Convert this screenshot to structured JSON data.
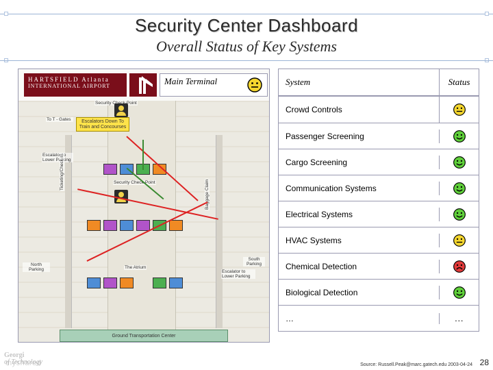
{
  "title": "Security Center Dashboard",
  "subtitle": "Overall Status of Key Systems",
  "map": {
    "brand_line1": "HARTSFIELD Atlanta",
    "brand_line2": "INTERNATIONAL AIRPORT",
    "header_label": "Main Terminal",
    "header_status": "neutral",
    "notice_text": "Escalators Down To Train and Concourses",
    "labels": {
      "security_checkpoint": "Security Check-Point",
      "checkpoint_top": "Security Check-Point",
      "gates": "To T - Gates",
      "escalator_left": "Escalator to Lower Parking",
      "escalator_right": "Escalator to Lower Parking",
      "north_parking": "North Parking",
      "south_parking": "South Parking",
      "ticketing": "Ticketing/Check-In",
      "baggage": "Baggage Claim",
      "atrium": "The Atrium",
      "ground_transport": "Ground Transportation Center"
    }
  },
  "status_table": {
    "header_system": "System",
    "header_status": "Status",
    "rows": [
      {
        "name": "Crowd Controls",
        "status": "neutral"
      },
      {
        "name": "Passenger Screening",
        "status": "ok"
      },
      {
        "name": "Cargo Screening",
        "status": "ok"
      },
      {
        "name": "Communication Systems",
        "status": "ok"
      },
      {
        "name": "Electrical Systems",
        "status": "ok"
      },
      {
        "name": "HVAC Systems",
        "status": "neutral"
      },
      {
        "name": "Chemical Detection",
        "status": "bad"
      },
      {
        "name": "Biological Detection",
        "status": "ok"
      },
      {
        "name": "…",
        "status": "text",
        "status_text": "…"
      }
    ]
  },
  "footer": {
    "source": "Source: Russell.Peak@marc.gatech.edu 2003-04-24",
    "page": "28",
    "org_line1": "Georgi",
    "org_line2": "of Technology",
    "watermark": "myshared"
  },
  "colors": {
    "ok": "#5fcf3a",
    "neutral": "#f4d62e",
    "bad": "#e23b3b"
  }
}
